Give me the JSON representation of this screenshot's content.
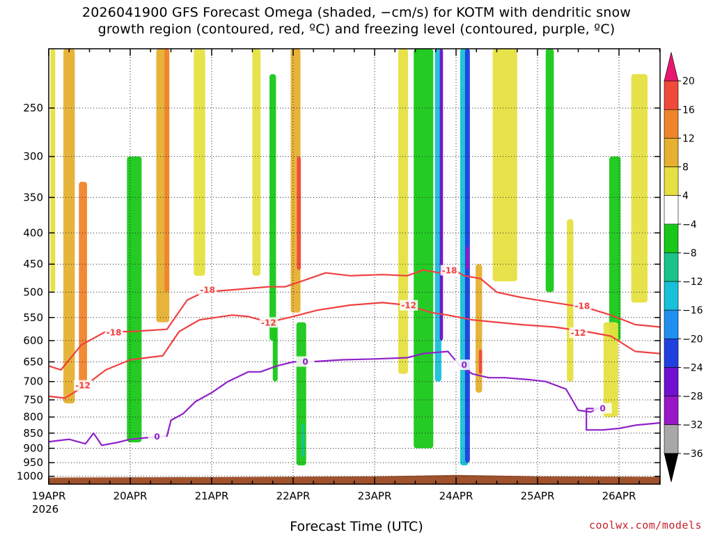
{
  "title": {
    "line1": "2026041900 GFS Forecast Omega (shaded, −cm/s) for KOTM with dendritic snow",
    "line2": "growth region (contoured, red, ºC) and freezing level (contoured, purple, ºC)"
  },
  "xlabel": "Forecast Time (UTC)",
  "year_label": "2026",
  "credit": "coolwx.com/models",
  "chart_data": {
    "type": "heatmap",
    "title": "2026041900 GFS Forecast Omega (shaded, −cm/s) for KOTM with dendritic snow growth region (contoured, red, ºC) and freezing level (contoured, purple, ºC)",
    "xlabel": "Forecast Time (UTC)",
    "ylabel": "",
    "x_ticks": [
      "19APR",
      "20APR",
      "21APR",
      "22APR",
      "23APR",
      "24APR",
      "25APR",
      "26APR"
    ],
    "y_ticks": [
      250,
      300,
      350,
      400,
      450,
      500,
      550,
      600,
      650,
      700,
      750,
      800,
      850,
      900,
      950,
      1000
    ],
    "xlim": [
      0,
      7.5
    ],
    "ylim": [
      1030,
      200
    ],
    "y_scale": "log-pressure",
    "grid": true,
    "colorbar": {
      "labels": [
        20,
        16,
        12,
        8,
        4,
        -4,
        -8,
        -12,
        -16,
        -20,
        -24,
        -28,
        -32,
        -36
      ],
      "colors": [
        "#e8176f",
        "#f04a3a",
        "#f0842a",
        "#e6b030",
        "#e6e040",
        "#ffffff",
        "#18c818",
        "#18c48c",
        "#18c0d8",
        "#2090f0",
        "#2040e0",
        "#7010d0",
        "#9818c8",
        "#a8a8a8",
        "#000000"
      ]
    },
    "omega_patches": [
      {
        "x": 0.25,
        "p_top": 200,
        "p_bot": 760,
        "w": 0.14,
        "value": 8
      },
      {
        "x": 0.42,
        "p_top": 330,
        "p_bot": 720,
        "w": 0.1,
        "value": 12
      },
      {
        "x": 0.05,
        "p_top": 200,
        "p_bot": 500,
        "w": 0.06,
        "value": 4
      },
      {
        "x": 1.05,
        "p_top": 300,
        "p_bot": 880,
        "w": 0.18,
        "value": -8
      },
      {
        "x": 1.4,
        "p_top": 200,
        "p_bot": 560,
        "w": 0.16,
        "value": 8
      },
      {
        "x": 1.45,
        "p_top": 200,
        "p_bot": 500,
        "w": 0.06,
        "value": 12
      },
      {
        "x": 1.85,
        "p_top": 200,
        "p_bot": 470,
        "w": 0.14,
        "value": 4
      },
      {
        "x": 2.55,
        "p_top": 200,
        "p_bot": 470,
        "w": 0.1,
        "value": 4
      },
      {
        "x": 2.75,
        "p_top": 220,
        "p_bot": 600,
        "w": 0.08,
        "value": -8
      },
      {
        "x": 3.03,
        "p_top": 200,
        "p_bot": 540,
        "w": 0.12,
        "value": 8
      },
      {
        "x": 3.07,
        "p_top": 300,
        "p_bot": 460,
        "w": 0.05,
        "value": 16
      },
      {
        "x": 3.1,
        "p_top": 560,
        "p_bot": 960,
        "w": 0.12,
        "value": -8
      },
      {
        "x": 3.12,
        "p_top": 820,
        "p_bot": 930,
        "w": 0.04,
        "value": -12
      },
      {
        "x": 2.78,
        "p_top": 560,
        "p_bot": 700,
        "w": 0.06,
        "value": -8
      },
      {
        "x": 4.35,
        "p_top": 200,
        "p_bot": 680,
        "w": 0.12,
        "value": 4
      },
      {
        "x": 4.6,
        "p_top": 200,
        "p_bot": 900,
        "w": 0.24,
        "value": -8
      },
      {
        "x": 4.78,
        "p_top": 200,
        "p_bot": 700,
        "w": 0.08,
        "value": -16
      },
      {
        "x": 4.82,
        "p_top": 200,
        "p_bot": 600,
        "w": 0.04,
        "value": -28
      },
      {
        "x": 5.1,
        "p_top": 200,
        "p_bot": 960,
        "w": 0.1,
        "value": -16
      },
      {
        "x": 5.14,
        "p_top": 200,
        "p_bot": 950,
        "w": 0.06,
        "value": -24
      },
      {
        "x": 5.14,
        "p_top": 420,
        "p_bot": 460,
        "w": 0.04,
        "value": -32
      },
      {
        "x": 5.28,
        "p_top": 450,
        "p_bot": 730,
        "w": 0.08,
        "value": 8
      },
      {
        "x": 5.3,
        "p_top": 620,
        "p_bot": 680,
        "w": 0.04,
        "value": 16
      },
      {
        "x": 5.6,
        "p_top": 200,
        "p_bot": 480,
        "w": 0.3,
        "value": 4
      },
      {
        "x": 6.15,
        "p_top": 200,
        "p_bot": 500,
        "w": 0.1,
        "value": -8
      },
      {
        "x": 6.4,
        "p_top": 380,
        "p_bot": 700,
        "w": 0.08,
        "value": 4
      },
      {
        "x": 6.95,
        "p_top": 300,
        "p_bot": 600,
        "w": 0.14,
        "value": -8
      },
      {
        "x": 7.25,
        "p_top": 220,
        "p_bot": 520,
        "w": 0.2,
        "value": 4
      },
      {
        "x": 6.9,
        "p_top": 560,
        "p_bot": 800,
        "w": 0.18,
        "value": 4
      }
    ],
    "series": [
      {
        "name": "-18",
        "color": "#f04040",
        "points": [
          [
            0,
            660
          ],
          [
            0.15,
            670
          ],
          [
            0.4,
            610
          ],
          [
            0.7,
            580
          ],
          [
            1.0,
            580
          ],
          [
            1.45,
            575
          ],
          [
            1.7,
            515
          ],
          [
            1.9,
            500
          ],
          [
            2.3,
            495
          ],
          [
            2.7,
            490
          ],
          [
            2.9,
            490
          ],
          [
            3.1,
            480
          ],
          [
            3.4,
            465
          ],
          [
            3.7,
            470
          ],
          [
            4.1,
            468
          ],
          [
            4.4,
            470
          ],
          [
            4.6,
            460
          ],
          [
            4.8,
            465
          ],
          [
            5.0,
            462
          ],
          [
            5.1,
            470
          ],
          [
            5.3,
            475
          ],
          [
            5.5,
            500
          ],
          [
            5.8,
            510
          ],
          [
            6.2,
            520
          ],
          [
            6.6,
            530
          ],
          [
            6.9,
            545
          ],
          [
            7.2,
            565
          ],
          [
            7.5,
            570
          ]
        ],
        "labels": [
          [
            0.8,
            582
          ],
          [
            1.95,
            496
          ],
          [
            4.92,
            461
          ],
          [
            6.55,
            527
          ]
        ]
      },
      {
        "name": "-12",
        "color": "#f04040",
        "points": [
          [
            0,
            740
          ],
          [
            0.2,
            745
          ],
          [
            0.45,
            710
          ],
          [
            0.7,
            670
          ],
          [
            1.0,
            645
          ],
          [
            1.4,
            635
          ],
          [
            1.6,
            580
          ],
          [
            1.85,
            555
          ],
          [
            2.25,
            545
          ],
          [
            2.45,
            548
          ],
          [
            2.7,
            560
          ],
          [
            2.95,
            550
          ],
          [
            3.3,
            535
          ],
          [
            3.7,
            525
          ],
          [
            4.1,
            520
          ],
          [
            4.4,
            525
          ],
          [
            4.7,
            540
          ],
          [
            4.9,
            545
          ],
          [
            5.2,
            555
          ],
          [
            5.5,
            560
          ],
          [
            5.8,
            565
          ],
          [
            6.2,
            570
          ],
          [
            6.6,
            580
          ],
          [
            6.9,
            590
          ],
          [
            7.2,
            625
          ],
          [
            7.5,
            630
          ]
        ],
        "labels": [
          [
            0.42,
            711
          ],
          [
            2.7,
            561
          ],
          [
            4.42,
            526
          ],
          [
            6.5,
            583
          ]
        ]
      },
      {
        "name": "0",
        "color": "#9020c8",
        "points": [
          [
            0,
            878
          ],
          [
            0.25,
            870
          ],
          [
            0.45,
            885
          ],
          [
            0.55,
            850
          ],
          [
            0.65,
            890
          ],
          [
            0.85,
            880
          ],
          [
            1.0,
            870
          ],
          [
            1.2,
            865
          ],
          [
            1.45,
            860
          ],
          [
            1.5,
            810
          ],
          [
            1.65,
            790
          ],
          [
            1.8,
            755
          ],
          [
            2.0,
            730
          ],
          [
            2.2,
            700
          ],
          [
            2.45,
            675
          ],
          [
            2.6,
            675
          ],
          [
            2.8,
            660
          ],
          [
            3.0,
            650
          ],
          [
            3.2,
            650
          ],
          [
            3.6,
            645
          ],
          [
            4.0,
            643
          ],
          [
            4.4,
            640
          ],
          [
            4.6,
            630
          ],
          [
            4.9,
            625
          ],
          [
            5.05,
            660
          ],
          [
            5.2,
            680
          ],
          [
            5.4,
            690
          ],
          [
            5.6,
            690
          ],
          [
            5.9,
            695
          ],
          [
            6.1,
            700
          ],
          [
            6.35,
            720
          ],
          [
            6.5,
            780
          ],
          [
            6.65,
            785
          ],
          [
            6.75,
            775
          ],
          [
            6.6,
            775
          ],
          [
            6.6,
            840
          ],
          [
            6.8,
            840
          ],
          [
            7.0,
            835
          ],
          [
            7.2,
            825
          ],
          [
            7.5,
            818
          ]
        ],
        "labels": [
          [
            1.33,
            862
          ],
          [
            3.15,
            650
          ],
          [
            5.1,
            658
          ],
          [
            6.8,
            775
          ]
        ]
      }
    ]
  }
}
